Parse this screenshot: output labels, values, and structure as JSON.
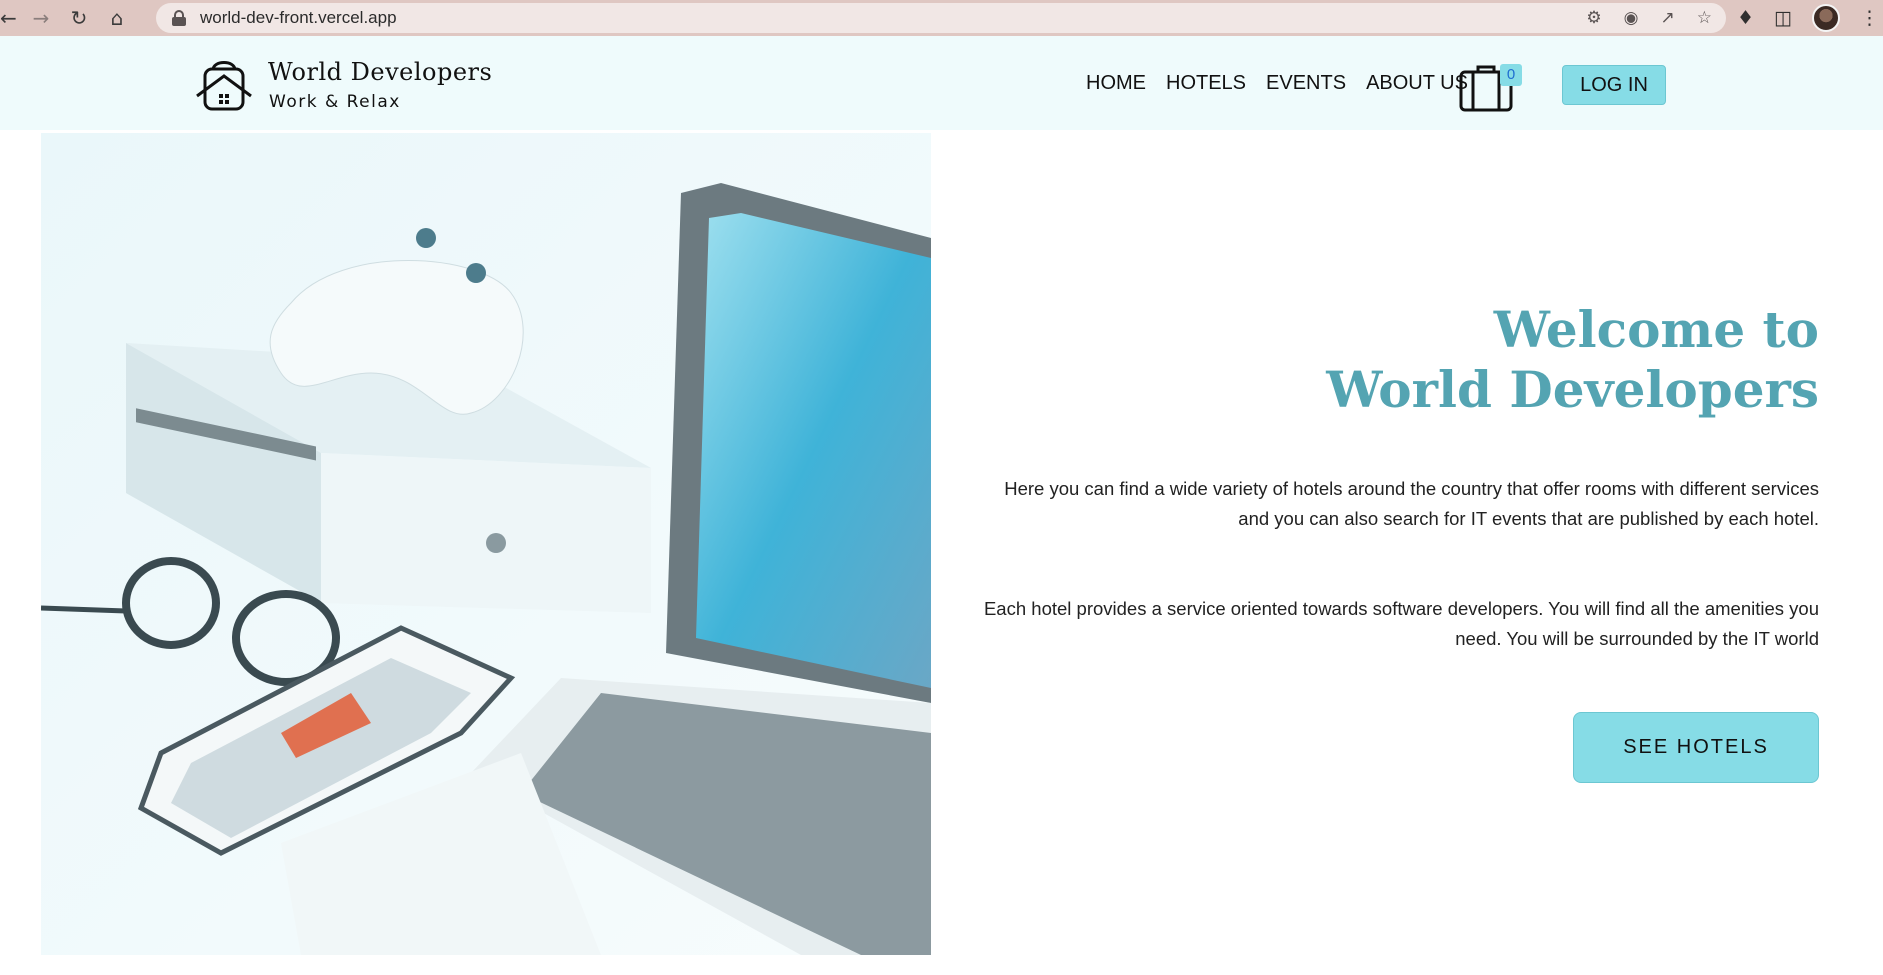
{
  "browser": {
    "url": "world-dev-front.vercel.app"
  },
  "header": {
    "brand_name": "World Developers",
    "brand_tagline": "Work & Relax",
    "nav": [
      "HOME",
      "HOTELS",
      "EVENTS",
      "ABOUT US"
    ],
    "cart_count": "0",
    "login_label": "LOG IN"
  },
  "hero": {
    "title_line1": "Welcome to",
    "title_line2": "World Developers",
    "paragraph1": "Here you can find a wide variety of hotels around the country that offer rooms with different services and you can also search for IT events that are published by each hotel.",
    "paragraph2": "Each hotel provides a service oriented towards software developers. You will find all the amenities you need. You will be surrounded by the IT world",
    "cta_label": "SEE HOTELS",
    "image": "desk with laptop, phone, glasses and game console"
  },
  "colors": {
    "accent": "#86dce6",
    "title": "#54a4b2",
    "header_bg": "#effbfc",
    "browser_bar": "#dfc7c2"
  }
}
